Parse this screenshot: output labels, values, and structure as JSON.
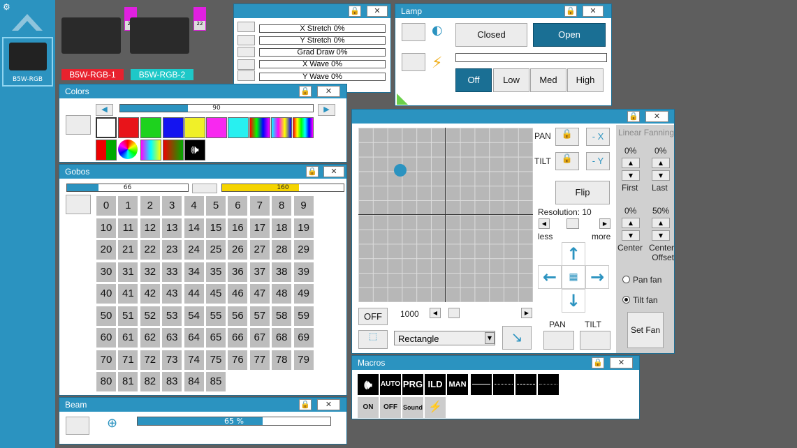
{
  "sidebar": {
    "settings_icon": "gear-icon",
    "fixture_label": "B5W-RGB"
  },
  "fixtures": [
    {
      "label": "B5W-RGB-1",
      "badge": "21",
      "color": "#e8222e"
    },
    {
      "label": "B5W-RGB-2",
      "badge": "22",
      "color": "#1ec8c8"
    }
  ],
  "effects": {
    "rows": [
      "X Stretch     0%",
      "Y Stretch     0%",
      "Grad Draw     0%",
      "X Wave     0%",
      "Y Wave     0%"
    ]
  },
  "lamp": {
    "title": "Lamp",
    "closed": "Closed",
    "open": "Open",
    "off": "Off",
    "low": "Low",
    "med": "Med",
    "high": "High"
  },
  "colors": {
    "title": "Colors",
    "slider_value": "90",
    "swatches": [
      "#ffffff",
      "#e8141a",
      "#1ed21e",
      "#1414f0",
      "#f0f028",
      "#f828f0",
      "#28f0f0"
    ]
  },
  "gobos": {
    "title": "Gobos",
    "bar1_value": "66",
    "bar2_value": "160",
    "numbers": [
      "0",
      "1",
      "2",
      "3",
      "4",
      "5",
      "6",
      "7",
      "8",
      "9",
      "10",
      "11",
      "12",
      "13",
      "14",
      "15",
      "16",
      "17",
      "18",
      "19",
      "20",
      "21",
      "22",
      "23",
      "24",
      "25",
      "26",
      "27",
      "28",
      "29",
      "30",
      "31",
      "32",
      "33",
      "34",
      "35",
      "36",
      "37",
      "38",
      "39",
      "40",
      "41",
      "42",
      "43",
      "44",
      "45",
      "46",
      "47",
      "48",
      "49",
      "50",
      "51",
      "52",
      "53",
      "54",
      "55",
      "56",
      "57",
      "58",
      "59",
      "60",
      "61",
      "62",
      "63",
      "64",
      "65",
      "66",
      "67",
      "68",
      "69",
      "70",
      "71",
      "72",
      "73",
      "74",
      "75",
      "76",
      "77",
      "78",
      "79",
      "80",
      "81",
      "82",
      "83",
      "84",
      "85"
    ]
  },
  "beam": {
    "title": "Beam",
    "value_text": "65 %",
    "value": 0.65
  },
  "position": {
    "pan": "PAN",
    "tilt": "TILT",
    "minus_x": "- X",
    "minus_y": "- Y",
    "flip": "Flip",
    "resolution": "Resolution: 10",
    "less": "less",
    "more": "more",
    "off": "OFF",
    "speed": "1000",
    "shape": "Rectangle",
    "pan_btn": "PAN",
    "tilt_btn": "TILT",
    "fanning_title": "Linear Fanning",
    "first_pct": "0%",
    "last_pct": "0%",
    "first": "First",
    "last": "Last",
    "center_pct": "0%",
    "offset_pct": "50%",
    "center": "Center",
    "center_offset": "Center\nOffset",
    "pan_fan": "Pan fan",
    "tilt_fan": "Tilt fan",
    "set_fan": "Set Fan"
  },
  "macros": {
    "title": "Macros",
    "items": [
      "AUTO",
      "PRG",
      "ILD",
      "MAN"
    ],
    "on": "ON",
    "off": "OFF",
    "sound": "Sound"
  }
}
